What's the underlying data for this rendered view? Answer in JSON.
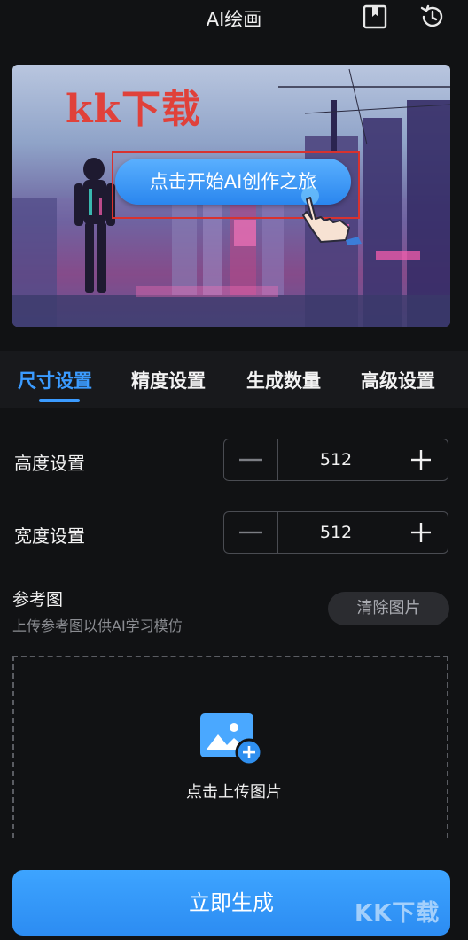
{
  "header": {
    "title": "AI绘画",
    "icons": [
      "bookmark-icon",
      "history-icon"
    ]
  },
  "banner": {
    "watermark": "kk下载",
    "start_button_label": "点击开始AI创作之旅",
    "accent_color": "#2a86ee",
    "highlight_color": "#d8322f"
  },
  "tabs": [
    {
      "label": "尺寸设置",
      "active": true
    },
    {
      "label": "精度设置",
      "active": false
    },
    {
      "label": "生成数量",
      "active": false
    },
    {
      "label": "高级设置",
      "active": false
    }
  ],
  "settings": {
    "height": {
      "label": "高度设置",
      "value": "512"
    },
    "width": {
      "label": "宽度设置",
      "value": "512"
    }
  },
  "reference": {
    "title": "参考图",
    "subtitle": "上传参考图以供AI学习模仿",
    "clear_button_label": "清除图片",
    "upload_label": "点击上传图片"
  },
  "footer": {
    "generate_button_label": "立即生成",
    "corner_watermark": "KK下载"
  }
}
